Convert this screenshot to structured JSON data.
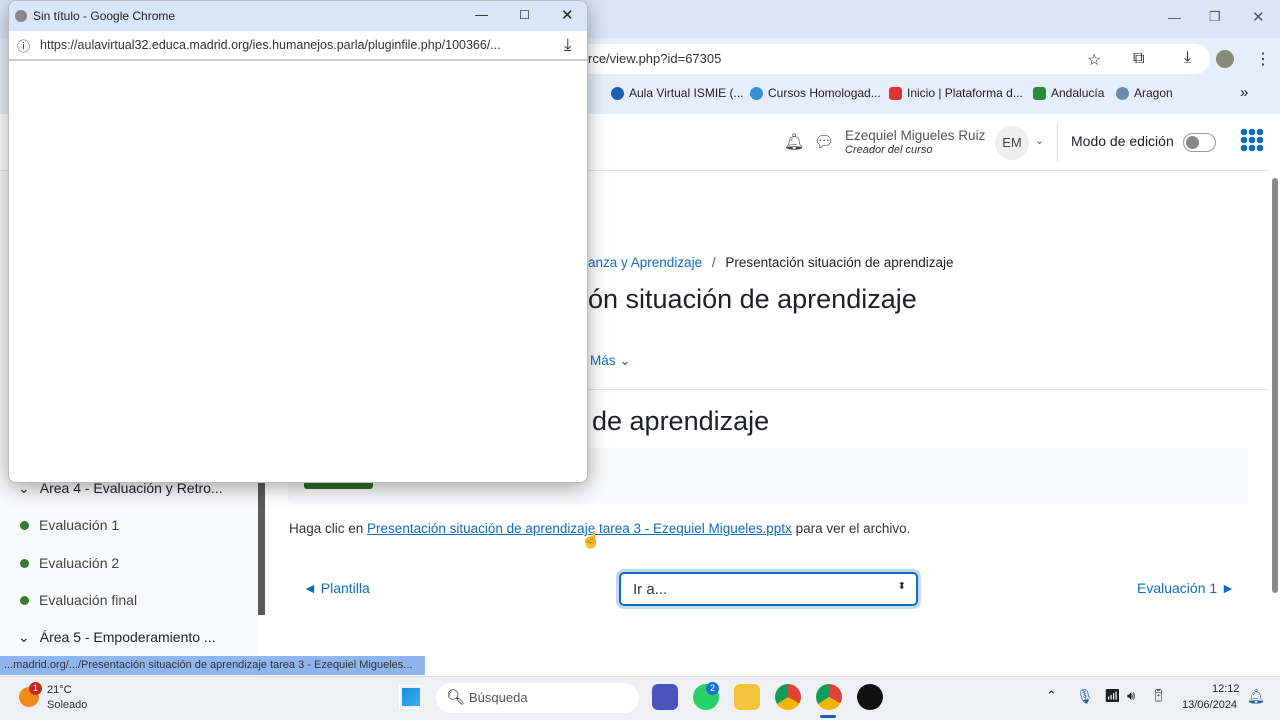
{
  "browser": {
    "url_partial": "rce/view.php?id=67305",
    "bookmarks": [
      "Aula Virtual ISMIE (...",
      "Cursos Homologad...",
      "Inicio | Plataforma d...",
      "Andalucía",
      "Aragon"
    ],
    "more": "»"
  },
  "header": {
    "user_name": "Ezequiel Migueles Ruiz",
    "user_role": "Creador del curso",
    "initials": "EM",
    "edit_mode_label": "Modo de edición"
  },
  "breadcrumb": {
    "parent": "anza y Aprendizaje",
    "sep": "/",
    "current": "Presentación situación de aprendizaje"
  },
  "page_title": "ón situación de aprendizaje",
  "more_tab": "Más",
  "section_heading": "de aprendizaje",
  "content": {
    "prefix": "Haga clic en ",
    "link": "Presentación situación de aprendizaje tarea 3 - Ezequiel Migueles.pptx",
    "suffix": " para ver el archivo."
  },
  "nav": {
    "prev": "◄ Plantilla",
    "select": "Ir a...",
    "next": "Evaluación 1 ►"
  },
  "sidebar": {
    "section4": "Área 4 - Evaluación y Retro...",
    "items": [
      "Evaluación 1",
      "Evaluación 2",
      "Evaluación final"
    ],
    "section5": "Área 5 - Empoderamiento ..."
  },
  "popup": {
    "title": "Sin título - Google Chrome",
    "url": "https://aulavirtual32.educa.madrid.org/ies.humanejos.parla/pluginfile.php/100366/..."
  },
  "status_url": "...madrid.org/.../Presentación situación de aprendizaje tarea 3 - Ezequiel Migueles...",
  "taskbar": {
    "temp": "21°C",
    "weather": "Soleado",
    "weather_badge": "1",
    "search": "Búsqueda",
    "whatsapp_badge": "2",
    "time": "12:12",
    "date": "13/06/2024"
  }
}
